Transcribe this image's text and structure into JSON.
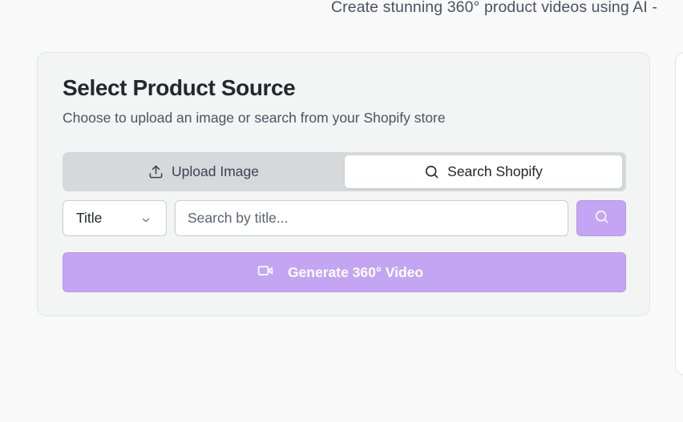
{
  "header": {
    "subtitle": "Create stunning 360° product videos using AI -"
  },
  "source_card": {
    "title": "Select Product Source",
    "description": "Choose to upload an image or search from your Shopify store",
    "tabs": [
      {
        "label": "Upload Image",
        "icon": "upload-icon",
        "active": false
      },
      {
        "label": "Search Shopify",
        "icon": "search-icon",
        "active": true
      }
    ],
    "search": {
      "field_selected": "Title",
      "placeholder": "Search by title...",
      "value": ""
    },
    "generate_label": "Generate 360° Video"
  },
  "colors": {
    "accent": "#c4a5f3",
    "tab_track": "#d6d8dc",
    "card_bg": "#f3f4f4",
    "page_bg": "#f9f9f9"
  }
}
